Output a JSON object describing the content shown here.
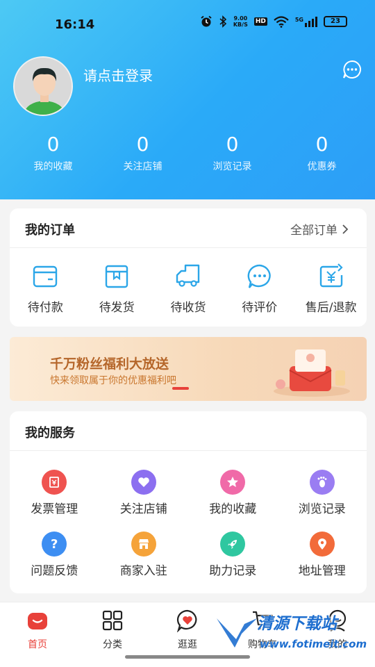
{
  "status_bar": {
    "time": "16:14",
    "network_speed_value": "9.00",
    "network_speed_unit": "KB/S",
    "hd": "HD",
    "net_type": "5G",
    "battery": "23"
  },
  "profile": {
    "login_prompt": "请点击登录"
  },
  "stats": [
    {
      "value": "0",
      "label": "我的收藏"
    },
    {
      "value": "0",
      "label": "关注店铺"
    },
    {
      "value": "0",
      "label": "浏览记录"
    },
    {
      "value": "0",
      "label": "优惠券"
    }
  ],
  "orders": {
    "title": "我的订单",
    "all_orders": "全部订单",
    "items": [
      {
        "label": "待付款",
        "icon": "wallet-icon"
      },
      {
        "label": "待发货",
        "icon": "package-icon"
      },
      {
        "label": "待收货",
        "icon": "truck-icon"
      },
      {
        "label": "待评价",
        "icon": "chat-bubble-icon"
      },
      {
        "label": "售后/退款",
        "icon": "refund-icon"
      }
    ]
  },
  "banner": {
    "title": "千万粉丝福利大放送",
    "subtitle": "快来领取属于你的优惠福利吧"
  },
  "services": {
    "title": "我的服务",
    "items": [
      {
        "label": "发票管理",
        "icon": "invoice-icon",
        "color": "#ef5350"
      },
      {
        "label": "关注店铺",
        "icon": "heart-icon",
        "color": "#8c6ff0"
      },
      {
        "label": "我的收藏",
        "icon": "star-icon",
        "color": "#f06aa8"
      },
      {
        "label": "浏览记录",
        "icon": "footprint-icon",
        "color": "#9a7df2"
      },
      {
        "label": "问题反馈",
        "icon": "question-icon",
        "color": "#3d8ef2"
      },
      {
        "label": "商家入驻",
        "icon": "store-icon",
        "color": "#f5a33a"
      },
      {
        "label": "助力记录",
        "icon": "rocket-icon",
        "color": "#2fc7a0"
      },
      {
        "label": "地址管理",
        "icon": "location-icon",
        "color": "#f26b3a"
      }
    ]
  },
  "tabbar": [
    {
      "label": "首页",
      "icon": "home-icon",
      "active": true
    },
    {
      "label": "分类",
      "icon": "grid-icon",
      "active": false
    },
    {
      "label": "逛逛",
      "icon": "heart-chat-icon",
      "active": false
    },
    {
      "label": "购物车",
      "icon": "cart-icon",
      "active": false
    },
    {
      "label": "我的",
      "icon": "profile-icon",
      "active": false
    }
  ],
  "watermark": {
    "text": "清源下载站",
    "url": "www.fotimeit.com"
  },
  "colors": {
    "accent": "#2aa7f7",
    "order_icon": "#2ba6e8",
    "tab_active": "#e8413a"
  }
}
